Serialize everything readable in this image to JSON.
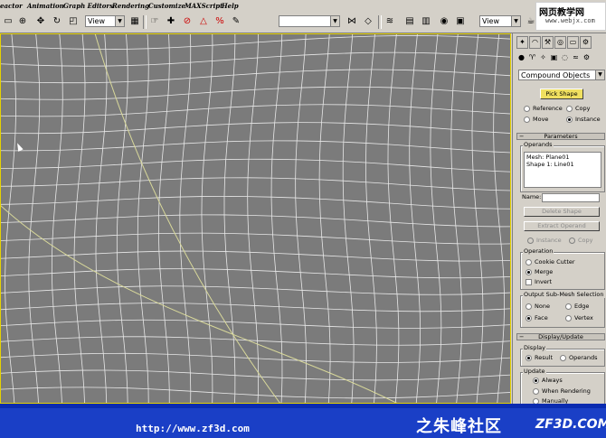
{
  "menubar": {
    "items": [
      "eactor",
      "Animation",
      "Graph Editors",
      "Rendering",
      "Customize",
      "MAXScript",
      "Help"
    ]
  },
  "toolbar": {
    "view_select_1": "View",
    "view_select_2": "View",
    "selection_set": ""
  },
  "watermark": {
    "line1": "网页教学网",
    "line2": "www.webjx.com"
  },
  "panel": {
    "dropdown": "Compound Objects",
    "pick_shape": "Pick Shape",
    "reference": "Reference",
    "copy": "Copy",
    "move": "Move",
    "instance": "Instance",
    "parameters": "Parameters",
    "operands_label": "Operands",
    "operands": [
      "Mesh: Plane01",
      "Shape 1: Line01"
    ],
    "name_label": "Name:",
    "delete_shape": "Delete Shape",
    "extract_operand": "Extract Operand",
    "extract_instance": "Instance",
    "extract_copy": "Copy",
    "operation_label": "Operation",
    "cookie_cutter": "Cookie Cutter",
    "merge": "Merge",
    "invert": "Invert",
    "output_label": "Output Sub-Mesh Selection",
    "none": "None",
    "edge": "Edge",
    "face": "Face",
    "vertex": "Vertex",
    "display_update": "Display/Update",
    "display_label": "Display",
    "result": "Result",
    "operands_opt": "Operands",
    "update_label": "Update",
    "always": "Always",
    "when_rendering": "When Rendering",
    "manually": "Manually"
  },
  "banner": {
    "url": "http://www.zf3d.com",
    "brand_cn": "之朱峰社区",
    "brand_en": "ZF3D.COM"
  }
}
